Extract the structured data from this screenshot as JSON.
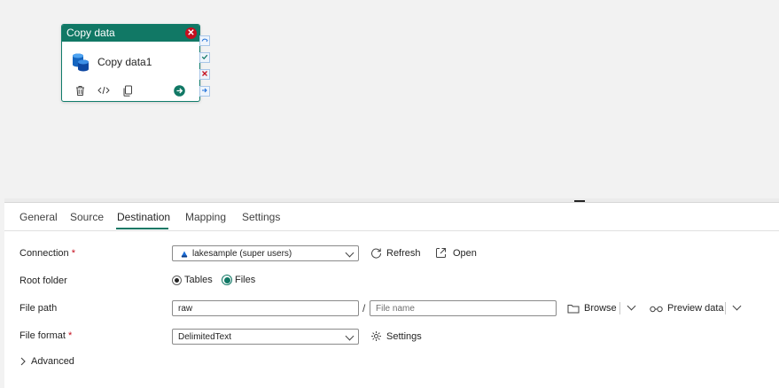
{
  "activity": {
    "type_label": "Copy data",
    "name": "Copy data1",
    "close_glyph": "✕",
    "tools": [
      "trash-icon",
      "code-icon",
      "copy-icon",
      "arrow-right-circle-icon"
    ],
    "ports": [
      "skip-port-icon",
      "success-port-icon",
      "fail-port-icon",
      "completion-port-icon"
    ]
  },
  "tabs": [
    {
      "label": "General"
    },
    {
      "label": "Source"
    },
    {
      "label": "Destination",
      "active": true
    },
    {
      "label": "Mapping"
    },
    {
      "label": "Settings"
    }
  ],
  "form": {
    "connection": {
      "label": "Connection",
      "required_mark": "*",
      "value": "lakesample (super users)",
      "refresh_label": "Refresh",
      "open_label": "Open"
    },
    "root_folder": {
      "label": "Root folder",
      "options": [
        "Tables",
        "Files"
      ],
      "selected": "Files"
    },
    "file_path": {
      "label": "File path",
      "folder_value": "raw",
      "separator": "/",
      "file_placeholder": "File name",
      "browse_label": "Browse",
      "preview_label": "Preview data"
    },
    "file_format": {
      "label": "File format",
      "required_mark": "*",
      "value": "DelimitedText",
      "settings_label": "Settings"
    },
    "advanced": {
      "label": "Advanced"
    }
  },
  "colors": {
    "accent": "#117865",
    "required": "#c50f1f",
    "canvas": "#f2f2f2"
  }
}
